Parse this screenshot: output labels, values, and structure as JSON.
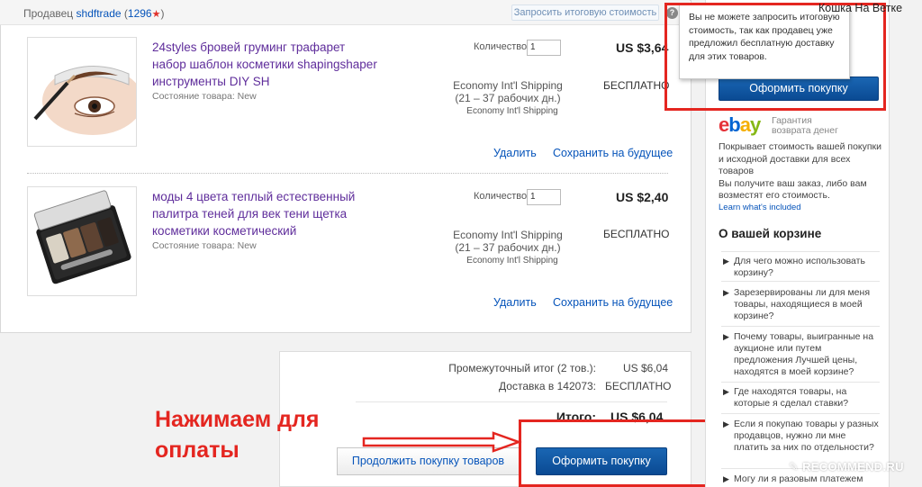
{
  "seller": {
    "label": "Продавец",
    "name": "shdftrade",
    "score_open": "(",
    "score": "1296",
    "score_close": ")",
    "request_total": "Запросить итоговую стоимость"
  },
  "items": [
    {
      "title": "24styles бровей груминг трафарет набор шаблон косметики shapingshaper инструменты DIY SH",
      "condition_label": "Состояние товара:",
      "condition": "New",
      "qty_label": "Количество:",
      "qty": "1",
      "price": "US $3,64",
      "shipping_method": "Economy Int'l Shipping",
      "shipping_days": "(21 – 37 рабочих дн.)",
      "shipping_method_small": "Economy Int'l Shipping",
      "shipping_cost": "БЕСПЛАТНО",
      "remove": "Удалить",
      "save_later": "Сохранить на будущее"
    },
    {
      "title": "моды 4 цвета теплый естественный палитра теней для век тени щетка косметики косметический",
      "condition_label": "Состояние товара:",
      "condition": "New",
      "qty_label": "Количество:",
      "qty": "1",
      "price": "US $2,40",
      "shipping_method": "Economy Int'l Shipping",
      "shipping_days": "(21 – 37 рабочих дн.)",
      "shipping_method_small": "Economy Int'l Shipping",
      "shipping_cost": "БЕСПЛАТНО",
      "remove": "Удалить",
      "save_later": "Сохранить на будущее"
    }
  ],
  "summary": {
    "subtotal_label": "Промежуточный итог (2 тов.):",
    "subtotal": "US $6,04",
    "delivery_label": "Доставка в 142073:",
    "delivery": "БЕСПЛАТНО",
    "total_label": "Итого:",
    "total": "US $6,04",
    "continue": "Продолжить покупку товаров",
    "checkout": "Оформить покупку"
  },
  "annotation": {
    "text_line1": "Нажимаем для",
    "text_line2": "оплаты"
  },
  "sidebar": {
    "tooltip": "Вы не можете запросить итоговую стоимость, так как продавец уже предложил бесплатную доставку для этих товаров.",
    "user": "Кошка На Ветке",
    "checkout": "Оформить покупку",
    "ebay_e": "e",
    "ebay_b": "b",
    "ebay_a": "a",
    "ebay_y": "y",
    "guarantee_line1": "Гарантия",
    "guarantee_line2": "возврата денег",
    "guarantee_text1": "Покрывает стоимость вашей покупки и исходной доставки для всех товаров",
    "guarantee_text2": "Вы получите ваш заказ, либо вам возместят его стоимость.",
    "learn": "Learn what's included",
    "about_title": "О вашей корзине",
    "faq": [
      "Для чего можно использовать корзину?",
      "Зарезервированы ли для меня товары, находящиеся в моей корзине?",
      "Почему товары, выигранные на аукционе или путем предложения Лучшей цены, находятся в моей корзине?",
      "Где находятся товары, на которые я сделал ставки?",
      "Если я покупаю товары у разных продавцов, нужно ли мне платить за них по отдельности?",
      "Могу ли я разовым платежем"
    ]
  },
  "watermark": "✎ RECOMMEND.RU",
  "colors": {
    "link": "#0654ba",
    "title": "#5f2d9b",
    "button": "#0a4a93",
    "annotation": "#e42620",
    "ebay_e": "#e53238",
    "ebay_b": "#0064d2",
    "ebay_a": "#f5af02",
    "ebay_y": "#86b817"
  }
}
